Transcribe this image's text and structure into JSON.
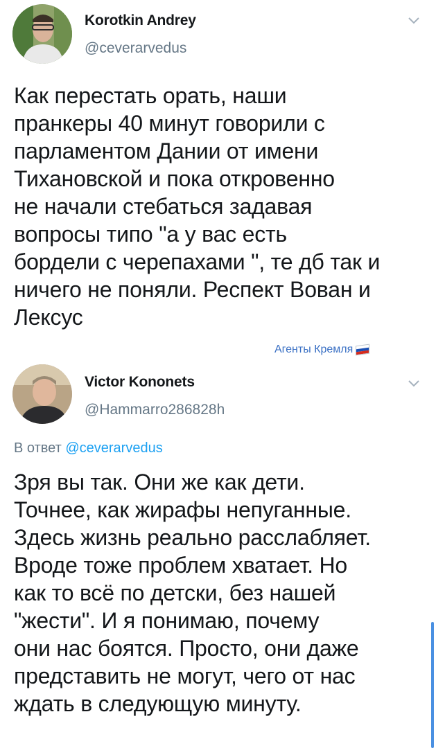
{
  "tweets": [
    {
      "author": {
        "display_name": "Korotkin Andrey",
        "handle": "@ceverarvedus"
      },
      "text": "Как перестать орать, наши\nпранкеры 40 минут говорили с\nпарламентом Дании от имени\nТихановской и пока откровенно\nне начали стебаться задавая\nвопросы типо \"а у вас есть\nбордели с черепахами \", те дб так и\nничего не поняли. Респект Вован и\nЛексус",
      "menu_icon": "chevron-down-icon"
    },
    {
      "author": {
        "display_name": "Victor Kononets",
        "handle": "@Hammarro286828h"
      },
      "reply_prefix": "В ответ",
      "reply_to": "@ceverarvedus",
      "text": "Зря вы так. Они же как дети.\nТочнее, как жирафы непуганные.\nЗдесь жизнь реально расслабляет.\nВроде тоже проблем хватает. Но\nкак то всё по детски, без нашей\n\"жести\". И я понимаю, почему\nони нас боятся. Просто, они даже\nпредставить не могут, чего от нас\nждать в следующую минуту.",
      "menu_icon": "chevron-down-icon"
    }
  ],
  "watermark": {
    "text": "Агенты Кремля",
    "icon": "russian-flag-icon"
  },
  "colors": {
    "text": "#14171a",
    "secondary": "#657786",
    "link": "#1da1f2",
    "watermark": "#3a70c4",
    "flag": [
      "#ffffff",
      "#1a4fb4",
      "#d52b1e"
    ]
  }
}
